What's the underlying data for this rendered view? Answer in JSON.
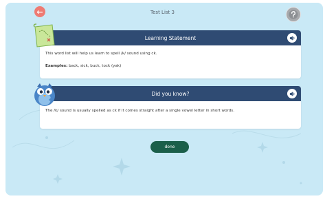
{
  "header": {
    "title": "Test List 3"
  },
  "learning_card": {
    "title": "Learning Statement",
    "description": "This word list will help us learn to spell /k/ sound using ck.",
    "examples_label": "Examples:",
    "examples_value": " back, sick, buck, tock (yak)"
  },
  "fact_card": {
    "title": "Did you know?",
    "text": "The /k/ sound is usually spelled as ck if it comes straight after a single vowel letter in short words."
  },
  "actions": {
    "done_label": "done"
  },
  "colors": {
    "background": "#c9e9f6",
    "card_header": "#2f4b73",
    "done_button": "#1b5f4a",
    "back_button": "#ee7b73"
  }
}
